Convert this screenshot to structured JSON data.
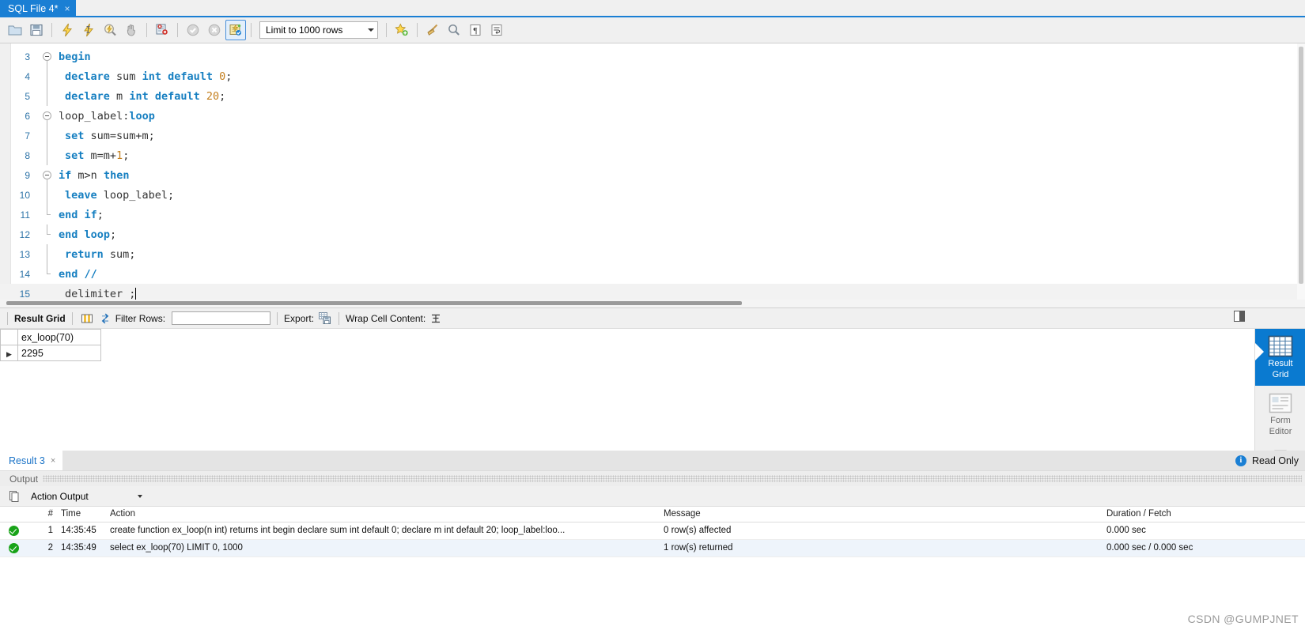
{
  "tab": {
    "title": "SQL File 4*",
    "close": "×"
  },
  "toolbar": {
    "limit_label": "Limit to 1000 rows",
    "buttons": [
      {
        "name": "open-sql-script-button",
        "icon": "folder-icon"
      },
      {
        "name": "save-sql-script-button",
        "icon": "floppy-disk-icon"
      },
      {
        "name": "execute-statement-button",
        "icon": "lightning-bolt-icon"
      },
      {
        "name": "execute-current-statement-button",
        "icon": "lightning-bolt-cursor-icon"
      },
      {
        "name": "explain-statement-button",
        "icon": "magnifier-bolt-icon"
      },
      {
        "name": "stop-statement-button",
        "icon": "hand-stop-icon"
      },
      {
        "name": "toggle-stop-on-error-button",
        "icon": "stop-on-error-icon"
      },
      {
        "name": "commit-transaction-button",
        "icon": "commit-check-icon"
      },
      {
        "name": "rollback-transaction-button",
        "icon": "rollback-cross-icon"
      },
      {
        "name": "toggle-autocommit-button",
        "icon": "autocommit-icon"
      },
      {
        "name": "beautify-query-button",
        "icon": "star-beautify-icon"
      },
      {
        "name": "clear-query-button",
        "icon": "broom-icon"
      },
      {
        "name": "find-button",
        "icon": "search-icon"
      },
      {
        "name": "toggle-invisible-chars-button",
        "icon": "pilcrow-icon"
      },
      {
        "name": "toggle-word-wrap-button",
        "icon": "wrap-text-icon"
      }
    ]
  },
  "editor": {
    "lines": [
      {
        "n": "3",
        "fold": "open",
        "indent": 0,
        "tokens": [
          {
            "t": "begin",
            "c": "kw"
          }
        ]
      },
      {
        "n": "4",
        "fold": "bar",
        "indent": 1,
        "tokens": [
          {
            "t": "declare",
            "c": "kw"
          },
          {
            "t": " ",
            "c": "op"
          },
          {
            "t": "sum",
            "c": "id"
          },
          {
            "t": " ",
            "c": "op"
          },
          {
            "t": "int",
            "c": "kw"
          },
          {
            "t": " ",
            "c": "op"
          },
          {
            "t": "default",
            "c": "kw"
          },
          {
            "t": " ",
            "c": "op"
          },
          {
            "t": "0",
            "c": "num"
          },
          {
            "t": ";",
            "c": "op"
          }
        ]
      },
      {
        "n": "5",
        "fold": "bar",
        "indent": 1,
        "tokens": [
          {
            "t": "declare",
            "c": "kw"
          },
          {
            "t": " ",
            "c": "op"
          },
          {
            "t": "m",
            "c": "id"
          },
          {
            "t": " ",
            "c": "op"
          },
          {
            "t": "int",
            "c": "kw"
          },
          {
            "t": " ",
            "c": "op"
          },
          {
            "t": "default",
            "c": "kw"
          },
          {
            "t": " ",
            "c": "op"
          },
          {
            "t": "20",
            "c": "num"
          },
          {
            "t": ";",
            "c": "op"
          }
        ]
      },
      {
        "n": "6",
        "fold": "open",
        "indent": 0,
        "tokens": [
          {
            "t": "loop_label:",
            "c": "id"
          },
          {
            "t": "loop",
            "c": "kw"
          }
        ]
      },
      {
        "n": "7",
        "fold": "bar",
        "indent": 1,
        "tokens": [
          {
            "t": "set",
            "c": "kw"
          },
          {
            "t": " ",
            "c": "op"
          },
          {
            "t": "sum=sum+m;",
            "c": "id"
          }
        ]
      },
      {
        "n": "8",
        "fold": "bar",
        "indent": 1,
        "tokens": [
          {
            "t": "set",
            "c": "kw"
          },
          {
            "t": " ",
            "c": "op"
          },
          {
            "t": "m=m+",
            "c": "id"
          },
          {
            "t": "1",
            "c": "num"
          },
          {
            "t": ";",
            "c": "op"
          }
        ]
      },
      {
        "n": "9",
        "fold": "open",
        "indent": 0,
        "tokens": [
          {
            "t": "if",
            "c": "kw"
          },
          {
            "t": " ",
            "c": "op"
          },
          {
            "t": "m>n",
            "c": "id"
          },
          {
            "t": " ",
            "c": "op"
          },
          {
            "t": "then",
            "c": "kw"
          }
        ]
      },
      {
        "n": "10",
        "fold": "bar",
        "indent": 1,
        "tokens": [
          {
            "t": "leave",
            "c": "kw"
          },
          {
            "t": " ",
            "c": "op"
          },
          {
            "t": "loop_label;",
            "c": "id"
          }
        ]
      },
      {
        "n": "11",
        "fold": "close",
        "indent": 0,
        "tokens": [
          {
            "t": "end if",
            "c": "kw"
          },
          {
            "t": ";",
            "c": "op"
          }
        ]
      },
      {
        "n": "12",
        "fold": "close",
        "indent": 0,
        "tokens": [
          {
            "t": "end loop",
            "c": "kw"
          },
          {
            "t": ";",
            "c": "op"
          }
        ]
      },
      {
        "n": "13",
        "fold": "bar",
        "indent": 1,
        "tokens": [
          {
            "t": "return",
            "c": "kw"
          },
          {
            "t": " ",
            "c": "op"
          },
          {
            "t": "sum;",
            "c": "id"
          }
        ]
      },
      {
        "n": "14",
        "fold": "close",
        "indent": 0,
        "tokens": [
          {
            "t": "end",
            "c": "kw"
          },
          {
            "t": " ",
            "c": "op"
          },
          {
            "t": "//",
            "c": "kw"
          }
        ]
      },
      {
        "n": "15",
        "fold": "none",
        "indent": 1,
        "current": true,
        "cursor": true,
        "tokens": [
          {
            "t": "delimiter ;",
            "c": "id"
          }
        ]
      }
    ]
  },
  "grid_toolbar": {
    "result_grid_label": "Result Grid",
    "filter_label": "Filter Rows:",
    "filter_value": "",
    "filter_placeholder": "",
    "export_label": "Export:",
    "wrap_label": "Wrap Cell Content:"
  },
  "grid": {
    "columns": [
      "ex_loop(70)"
    ],
    "rows": [
      [
        "2295"
      ]
    ]
  },
  "side_panel": {
    "items": [
      {
        "label_line1": "Result",
        "label_line2": "Grid",
        "active": true
      },
      {
        "label_line1": "Form",
        "label_line2": "Editor",
        "active": false
      }
    ]
  },
  "result_tab": {
    "label": "Result 3",
    "close": "×"
  },
  "readonly": {
    "icon": "info-icon",
    "label": "Read Only"
  },
  "output": {
    "section_title": "Output",
    "selector_label": "Action Output",
    "columns": [
      "#",
      "Time",
      "Action",
      "Message",
      "Duration / Fetch"
    ],
    "rows": [
      {
        "status": "success",
        "num": "1",
        "time": "14:35:45",
        "action": "create function ex_loop(n int) returns int begin declare sum int default 0; declare m int default 20; loop_label:loo...",
        "message": "0 row(s) affected",
        "duration": "0.000 sec"
      },
      {
        "status": "success",
        "num": "2",
        "time": "14:35:49",
        "action": "select ex_loop(70) LIMIT 0, 1000",
        "message": "1 row(s) returned",
        "duration": "0.000 sec / 0.000 sec"
      }
    ]
  },
  "watermark": {
    "text": "CSDN @GUMPJNET"
  },
  "colors": {
    "accent": "#1a7fd4",
    "keyword": "#167fc1",
    "number": "#c47f1e",
    "success": "#19a319"
  }
}
